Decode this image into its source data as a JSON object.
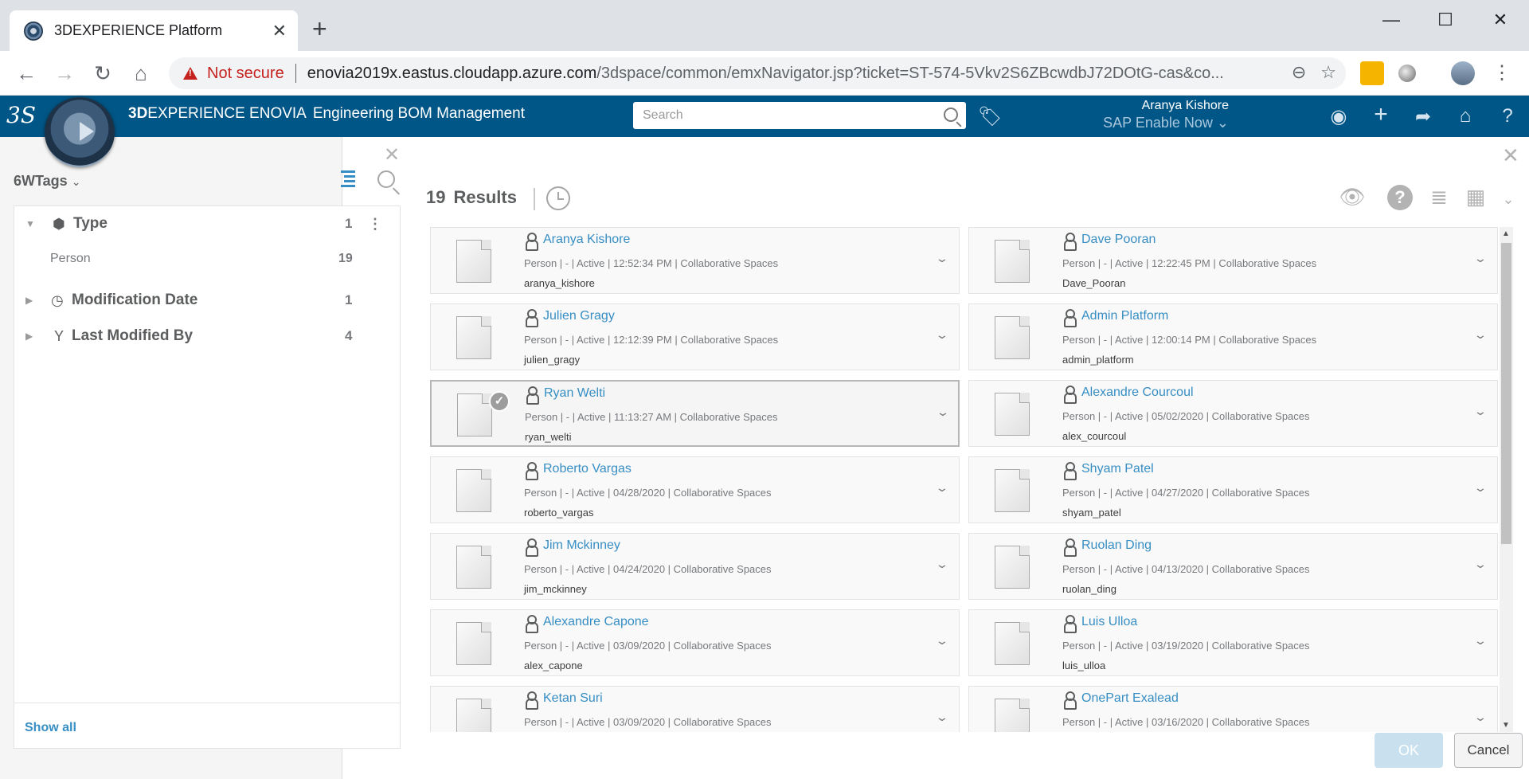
{
  "browser": {
    "tab_title": "3DEXPERIENCE Platform",
    "tab_close": "✕",
    "new_tab": "+",
    "security_label": "Not secure",
    "url_host": "enovia2019x.eastus.cloudapp.azure.com",
    "url_path": "/3dspace/common/emxNavigator.jsp?ticket=ST-574-5Vkv2S6ZBcwdbJ72DOtG-cas&co...",
    "minimize": "—",
    "maximize": "☐",
    "close": "✕",
    "back": "←",
    "forward": "→",
    "reload": "↻",
    "home": "⌂",
    "zoom_icon": "⊖",
    "star_icon": "☆",
    "menu_icon": "⋮"
  },
  "app": {
    "ds_logo": "3S",
    "brand": "3DEXPERIENCE ENOVIA",
    "brand_bold": "3D",
    "brand_rest": "EXPERIENCE ENOVIA",
    "module": "Engineering BOM Management",
    "search_placeholder": "Search",
    "user_name": "Aranya Kishore",
    "context": "SAP Enable Now ⌄",
    "icons": [
      "user-icon",
      "plus-icon",
      "share-icon",
      "home-icon",
      "help-icon"
    ]
  },
  "filter_panel": {
    "title": "6WTags",
    "title_chevron": "⌄",
    "close": "✕",
    "facets": [
      {
        "label": "Type",
        "count": "1",
        "expanded": true,
        "tri": "▼",
        "icon": "cube-icon",
        "glyph": "⬢",
        "more": "⋮"
      },
      {
        "label": "Modification Date",
        "count": "1",
        "expanded": false,
        "tri": "▶",
        "icon": "clock-icon",
        "glyph": "◷"
      },
      {
        "label": "Last Modified By",
        "count": "4",
        "expanded": false,
        "tri": "▶",
        "icon": "branch-icon",
        "glyph": "Y"
      }
    ],
    "sub_items": [
      {
        "label": "Person",
        "count": "19"
      }
    ],
    "show_all": "Show all"
  },
  "results": {
    "count": "19",
    "label": "Results",
    "close": "✕",
    "eye_glyph": "👁",
    "help_glyph": "?",
    "list_glyph": "≣",
    "tile_glyph": "▦",
    "view_chevron": "⌄",
    "cards": [
      {
        "name": "Aranya Kishore",
        "meta": "Person | - | Active | 12:52:34 PM | Collaborative Spaces",
        "login": "aranya_kishore",
        "selected": false
      },
      {
        "name": "Dave Pooran",
        "meta": "Person | - | Active | 12:22:45 PM | Collaborative Spaces",
        "login": "Dave_Pooran",
        "selected": false
      },
      {
        "name": "Julien Gragy",
        "meta": "Person | - | Active | 12:12:39 PM | Collaborative Spaces",
        "login": "julien_gragy",
        "selected": false
      },
      {
        "name": "Admin Platform",
        "meta": "Person | - | Active | 12:00:14 PM | Collaborative Spaces",
        "login": "admin_platform",
        "selected": false
      },
      {
        "name": "Ryan Welti",
        "meta": "Person | - | Active | 11:13:27 AM | Collaborative Spaces",
        "login": "ryan_welti",
        "selected": true
      },
      {
        "name": "Alexandre Courcoul",
        "meta": "Person | - | Active | 05/02/2020 | Collaborative Spaces",
        "login": "alex_courcoul",
        "selected": false
      },
      {
        "name": "Roberto Vargas",
        "meta": "Person | - | Active | 04/28/2020 | Collaborative Spaces",
        "login": "roberto_vargas",
        "selected": false
      },
      {
        "name": "Shyam Patel",
        "meta": "Person | - | Active | 04/27/2020 | Collaborative Spaces",
        "login": "shyam_patel",
        "selected": false
      },
      {
        "name": "Jim Mckinney",
        "meta": "Person | - | Active | 04/24/2020 | Collaborative Spaces",
        "login": "jim_mckinney",
        "selected": false
      },
      {
        "name": "Ruolan Ding",
        "meta": "Person | - | Active | 04/13/2020 | Collaborative Spaces",
        "login": "ruolan_ding",
        "selected": false
      },
      {
        "name": "Alexandre Capone",
        "meta": "Person | - | Active | 03/09/2020 | Collaborative Spaces",
        "login": "alex_capone",
        "selected": false
      },
      {
        "name": "Luis Ulloa",
        "meta": "Person | - | Active | 03/19/2020 | Collaborative Spaces",
        "login": "luis_ulloa",
        "selected": false
      },
      {
        "name": "Ketan Suri",
        "meta": "Person | - | Active | 03/09/2020 | Collaborative Spaces",
        "login": "",
        "selected": false
      },
      {
        "name": "OnePart Exalead",
        "meta": "Person | - | Active | 03/16/2020 | Collaborative Spaces",
        "login": "",
        "selected": false
      }
    ]
  },
  "dialog": {
    "ok_label": "OK",
    "cancel_label": "Cancel"
  },
  "colors": {
    "app_bar": "#005686",
    "link": "#368ec4",
    "danger": "#c5221f"
  }
}
